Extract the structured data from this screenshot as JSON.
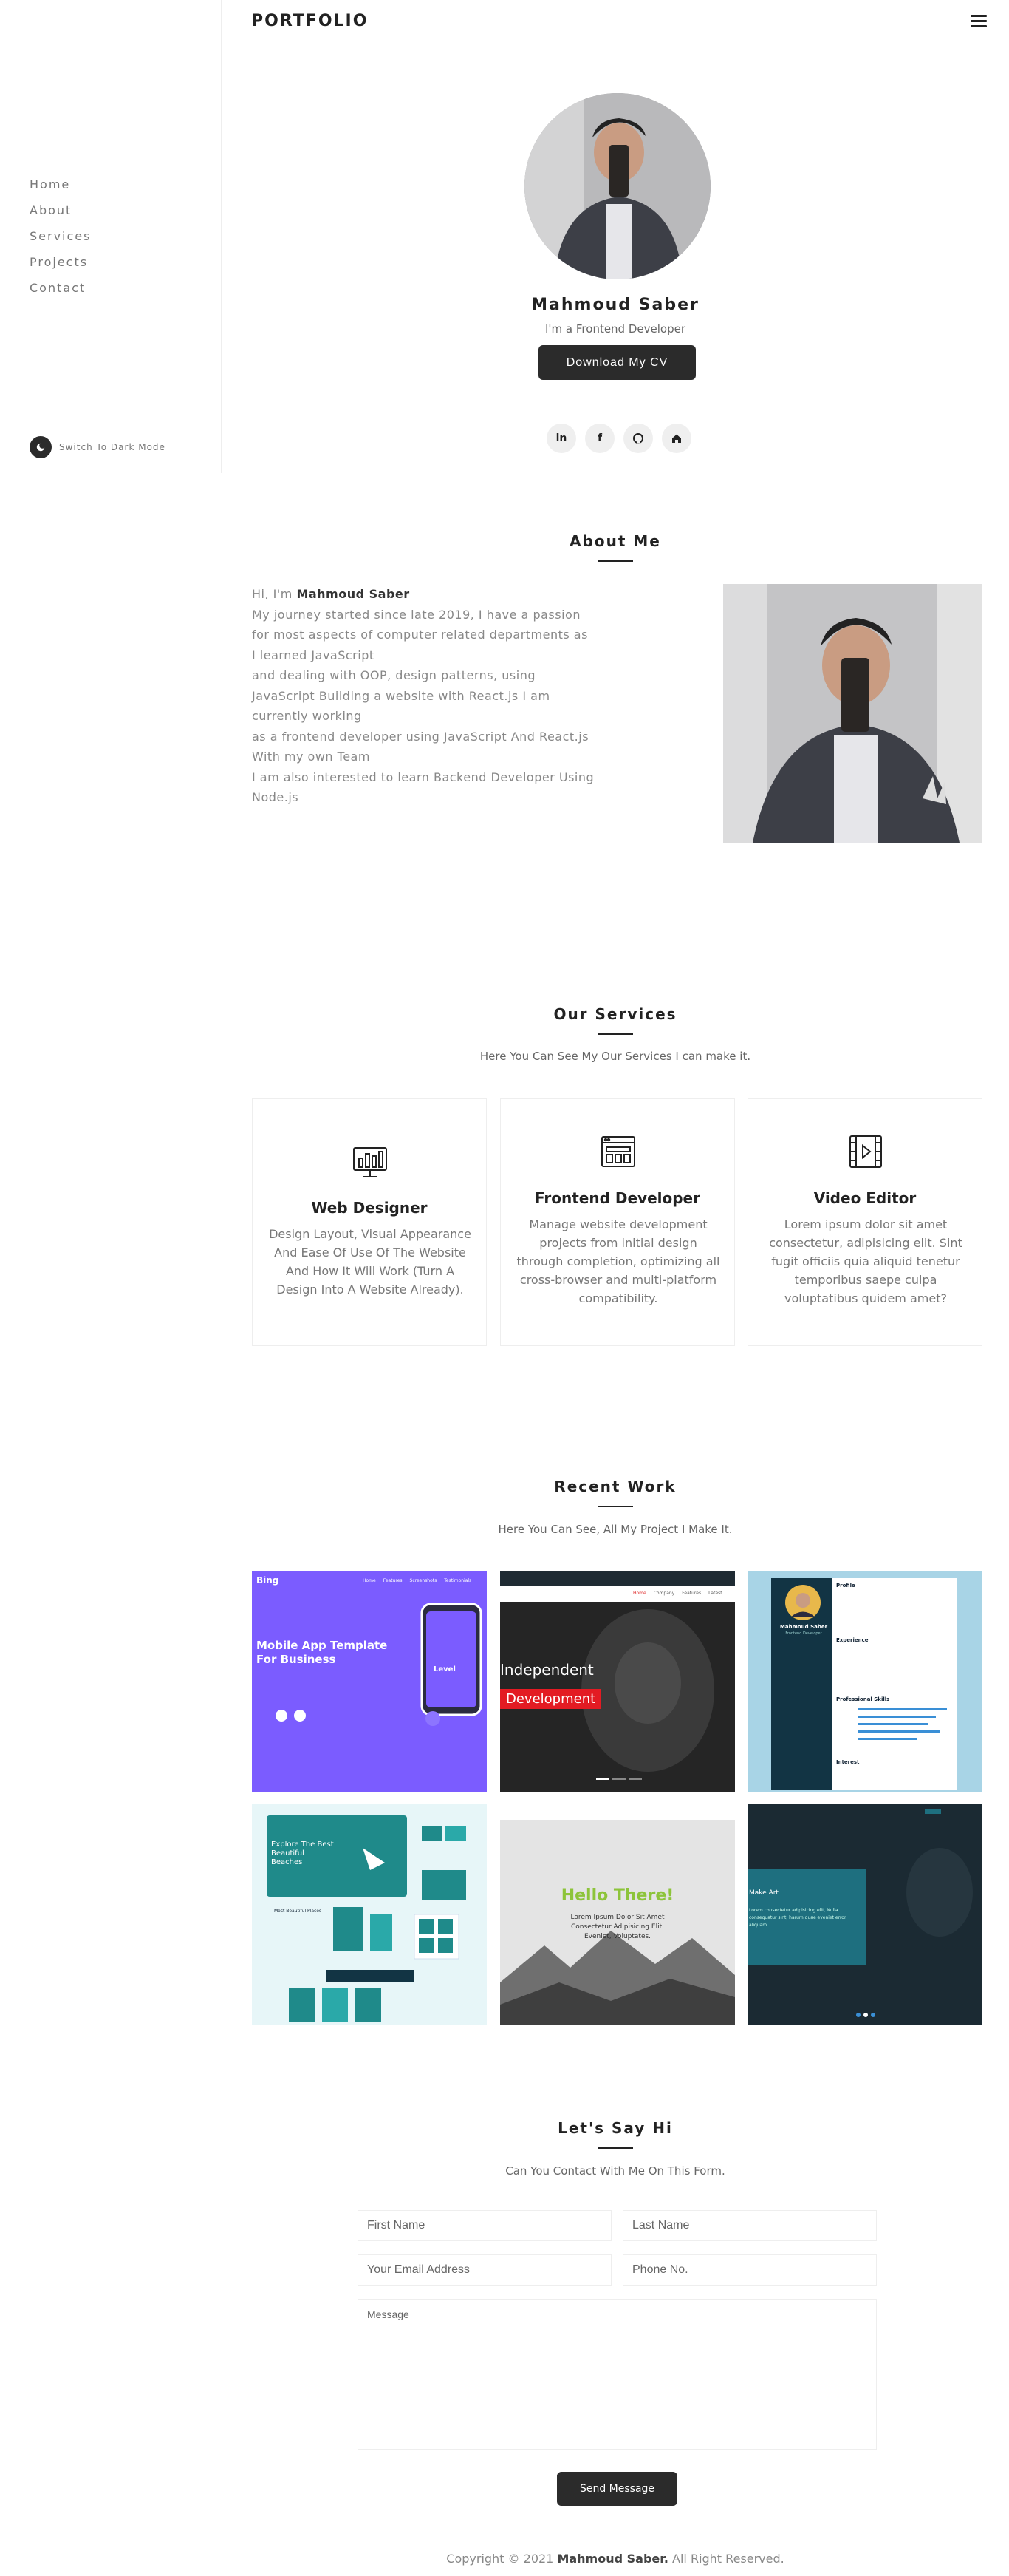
{
  "sidebar": {
    "nav": [
      "Home",
      "About",
      "Services",
      "Projects",
      "Contact"
    ],
    "dark_mode_label": "Switch To Dark Mode"
  },
  "header": {
    "brand": "PORTFOLIO"
  },
  "hero": {
    "name": "Mahmoud Saber",
    "role": "I'm a Frontend Developer",
    "cv_button": "Download My CV",
    "socials": [
      "linkedin-icon",
      "facebook-icon",
      "github-icon",
      "home-icon"
    ]
  },
  "about": {
    "title": "About Me",
    "greeting": "Hi, I'm ",
    "name": "Mahmoud Saber",
    "lines": [
      "My journey started since late 2019, I have a passion",
      "for most aspects of computer related departments as",
      "I learned JavaScript",
      "and dealing with OOP, design patterns, using",
      "JavaScript Building a website with React.js I am",
      "currently working",
      "as a frontend developer using JavaScript And React.js",
      "With my own Team",
      "I am also interested to learn Backend Developer Using",
      "Node.js"
    ]
  },
  "services": {
    "title": "Our Services",
    "subtitle": "Here You Can See My Our Services I can make it.",
    "items": [
      {
        "icon": "monitor-chart-icon",
        "title": "Web Designer",
        "desc": "Design Layout, Visual Appearance And Ease Of Use Of The Website And How It Will Work (Turn A Design Into A Website Already)."
      },
      {
        "icon": "browser-window-icon",
        "title": "Frontend Developer",
        "desc": "Manage website development projects from initial design through completion, optimizing all cross-browser and multi-platform compatibility."
      },
      {
        "icon": "video-play-icon",
        "title": "Video Editor",
        "desc": "Lorem ipsum dolor sit amet consectetur, adipisicing elit. Sint fugit officiis quia aliquid tenetur temporibus saepe culpa voluptatibus quidem amet?"
      }
    ]
  },
  "work": {
    "title": "Recent Work",
    "subtitle": "Here You Can See, All My Project I Make It.",
    "projects": [
      {
        "heading": "Mobile App Template For Business",
        "logo": "Bing",
        "nav": [
          "Home",
          "Features",
          "Screenshots",
          "Testimonials"
        ],
        "phone_label": "Level"
      },
      {
        "heading": "Independent",
        "tag": "Development",
        "nav": [
          "Home",
          "Company",
          "Features",
          "Latest"
        ]
      },
      {
        "resume_name": "Mahmoud Saber",
        "resume_role": "Frontend Developer",
        "sections": [
          "Profile",
          "Experience",
          "Professional Skills",
          "Interest"
        ]
      },
      {
        "heading": "Explore The Best Beautiful Beaches",
        "sub": "Most Beautiful Places"
      },
      {
        "heading": "Hello There!",
        "text": "Lorem Ipsum Dolor Sit Amet Consectetur Adipisicing Elit. Eveniet, Voluptates."
      },
      {
        "heading": "Make Art",
        "text": "Lorem consectetur adipisicing elit, Nulla consequatur sint, harum quae eveniet error aliquam."
      }
    ]
  },
  "contact": {
    "title": "Let's Say Hi",
    "subtitle": "Can You Contact With Me On This Form.",
    "first_name": "First Name",
    "last_name": "Last Name",
    "email": "Your Email Address",
    "phone": "Phone No.",
    "message": "Message",
    "send": "Send Message"
  },
  "footer": {
    "prefix": "Copyright © 2021 ",
    "name": "Mahmoud Saber.",
    "suffix": " All Right Reserved."
  },
  "colors": {
    "dark": "#2b2b2b",
    "accent_purple": "#7b5cff",
    "accent_teal": "#1f8a8a",
    "accent_green": "#8dc43a"
  }
}
